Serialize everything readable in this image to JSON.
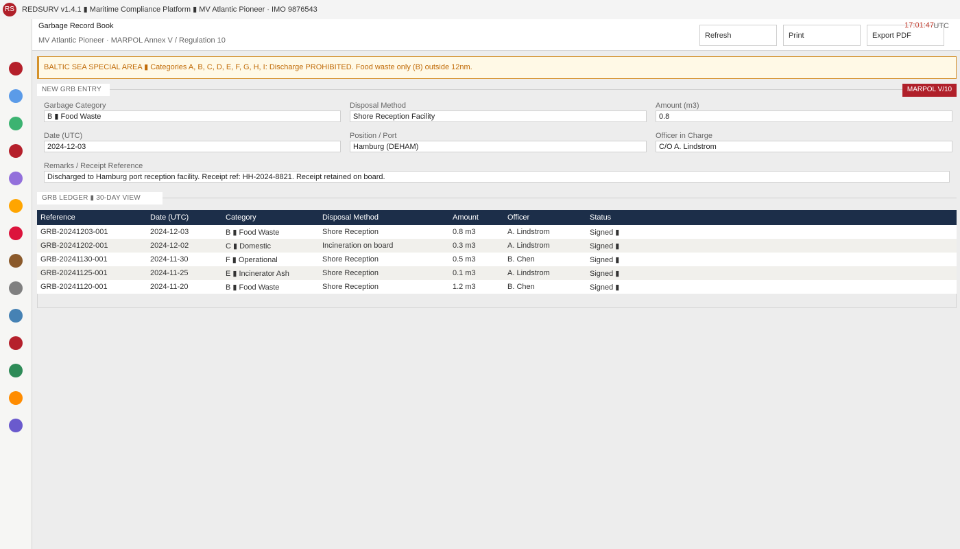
{
  "app": {
    "logo": "RS",
    "title": "REDSURV v1.4.1 ▮ Maritime Compliance Platform ▮ MV Atlantic Pioneer · IMO 9876543"
  },
  "sidebar": {
    "items": [
      {
        "icon": "red-circle-icon",
        "color": "#b5202b"
      },
      {
        "icon": "blue-circle-icon",
        "color": "#5b9be8"
      },
      {
        "icon": "green-circle-icon",
        "color": "#3cb371"
      },
      {
        "icon": "red-circle-icon",
        "color": "#b5202b"
      },
      {
        "icon": "purple-circle-icon",
        "color": "#9370db"
      },
      {
        "icon": "orange-circle-icon",
        "color": "#ffa500"
      },
      {
        "icon": "crimson-circle-icon",
        "color": "#dc143c"
      },
      {
        "icon": "brown-circle-icon",
        "color": "#8b5a2b"
      },
      {
        "icon": "gray-circle-icon",
        "color": "#808080"
      },
      {
        "icon": "steelblue-circle-icon",
        "color": "#4682b4"
      },
      {
        "icon": "red-circle-icon",
        "color": "#b5202b"
      },
      {
        "icon": "seagreen-circle-icon",
        "color": "#2e8b57"
      },
      {
        "icon": "darkorange-circle-icon",
        "color": "#ff8c00"
      },
      {
        "icon": "slateblue-circle-icon",
        "color": "#6a5acd"
      }
    ]
  },
  "header": {
    "title": "Garbage Record Book",
    "subtitle": "MV Atlantic Pioneer · MARPOL Annex V / Regulation 10",
    "clock": "17:01:47",
    "timezone": "UTC",
    "buttons": {
      "refresh": "Refresh",
      "print": "Print",
      "export": "Export PDF"
    }
  },
  "banner": {
    "text": "BALTIC SEA SPECIAL AREA ▮ Categories A, B, C, D, E, F, G, H, I: Discharge PROHIBITED. Food waste only (B) outside 12nm."
  },
  "entry": {
    "section_title": "NEW GRB ENTRY",
    "badge": "MARPOL V/10",
    "fields": {
      "category": {
        "label": "Garbage Category",
        "value": "B ▮ Food Waste"
      },
      "method": {
        "label": "Disposal Method",
        "value": "Shore Reception Facility"
      },
      "amount": {
        "label": "Amount (m3)",
        "value": "0.8"
      },
      "date": {
        "label": "Date (UTC)",
        "value": "2024-12-03"
      },
      "position": {
        "label": "Position / Port",
        "value": "Hamburg (DEHAM)"
      },
      "officer": {
        "label": "Officer in Charge",
        "value": "C/O A. Lindstrom"
      },
      "remarks": {
        "label": "Remarks / Receipt Reference",
        "value": "Discharged to Hamburg port reception facility. Receipt ref: HH-2024-8821. Receipt retained on board."
      }
    }
  },
  "ledger": {
    "section_title": "GRB LEDGER ▮ 30-DAY VIEW",
    "columns": [
      "Reference",
      "Date (UTC)",
      "Category",
      "Disposal Method",
      "Amount",
      "Officer",
      "Status"
    ],
    "rows": [
      [
        "GRB-20241203-001",
        "2024-12-03",
        "B ▮ Food Waste",
        "Shore Reception",
        "0.8 m3",
        "A. Lindstrom",
        "Signed ▮"
      ],
      [
        "GRB-20241202-001",
        "2024-12-02",
        "C ▮ Domestic",
        "Incineration on board",
        "0.3 m3",
        "A. Lindstrom",
        "Signed ▮"
      ],
      [
        "GRB-20241130-001",
        "2024-11-30",
        "F ▮ Operational",
        "Shore Reception",
        "0.5 m3",
        "B. Chen",
        "Signed ▮"
      ],
      [
        "GRB-20241125-001",
        "2024-11-25",
        "E ▮ Incinerator Ash",
        "Shore Reception",
        "0.1 m3",
        "A. Lindstrom",
        "Signed ▮"
      ],
      [
        "GRB-20241120-001",
        "2024-11-20",
        "B ▮ Food Waste",
        "Shore Reception",
        "1.2 m3",
        "B. Chen",
        "Signed ▮"
      ]
    ]
  }
}
